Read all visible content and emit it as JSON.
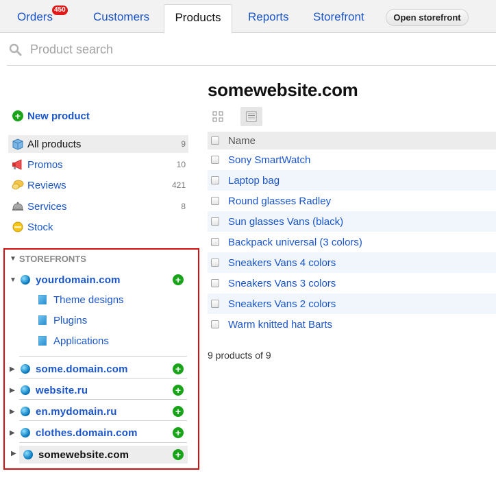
{
  "tabs": {
    "orders": "Orders",
    "orders_badge": "450",
    "customers": "Customers",
    "products": "Products",
    "reports": "Reports",
    "storefront": "Storefront",
    "open_storefront": "Open storefront"
  },
  "search": {
    "placeholder": "Product search"
  },
  "sidebar": {
    "new_product": "New product",
    "items": [
      {
        "label": "All products",
        "count": "9",
        "icon": "box-icon"
      },
      {
        "label": "Promos",
        "count": "10",
        "icon": "megaphone-icon"
      },
      {
        "label": "Reviews",
        "count": "421",
        "icon": "reviews-icon"
      },
      {
        "label": "Services",
        "count": "8",
        "icon": "service-bell-icon"
      },
      {
        "label": "Stock",
        "count": "",
        "icon": "stock-icon"
      }
    ],
    "storefronts_heading": "STOREFRONTS",
    "storefronts": [
      {
        "label": "yourdomain.com",
        "sub": [
          "Theme designs",
          "Plugins",
          "Applications"
        ]
      },
      {
        "label": "some.domain.com"
      },
      {
        "label": "website.ru"
      },
      {
        "label": "en.mydomain.ru"
      },
      {
        "label": "clothes.domain.com"
      },
      {
        "label": "somewebsite.com"
      }
    ]
  },
  "main": {
    "title": "somewebsite.com",
    "column_name": "Name",
    "products": [
      "Sony SmartWatch",
      "Laptop bag",
      "Round glasses Radley",
      "Sun glasses Vans (black)",
      "Backpack universal (3 colors)",
      "Sneakers Vans 4 colors",
      "Sneakers Vans 3 colors",
      "Sneakers Vans 2 colors",
      "Warm knitted hat Barts"
    ],
    "count_text": "9 products of 9"
  },
  "colors": {
    "link": "#1a55c9",
    "highlight_border": "#d40f0f",
    "badge": "#e01919",
    "add": "#19a319"
  }
}
